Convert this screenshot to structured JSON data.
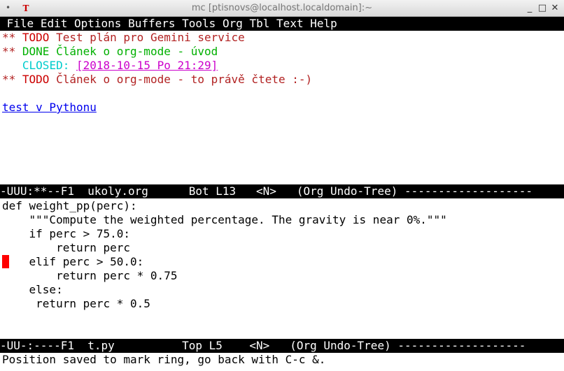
{
  "window": {
    "title": "mc [ptisnovs@localhost.localdomain]:~",
    "menu_glyph": "•",
    "app_icon": "T",
    "minimize": "_",
    "maximize": "□",
    "close": "✕"
  },
  "menubar": [
    "File",
    "Edit",
    "Options",
    "Buffers",
    "Tools",
    "Org",
    "Tbl",
    "Text",
    "Help"
  ],
  "org_buffer": {
    "lines": [
      {
        "stars": "**",
        "keyword": "TODO",
        "text": "Test plán pro Gemini service"
      },
      {
        "stars": "**",
        "keyword": "DONE",
        "text": "Článek o org-mode - úvod"
      },
      {
        "closed_label": "CLOSED:",
        "timestamp": "[2018-10-15 Po 21:29]"
      },
      {
        "stars": "**",
        "keyword": "TODO",
        "text": "Článek o org-mode - to právě čtete :-)"
      }
    ],
    "link": "test v Pythonu"
  },
  "modeline_top": "-UUU:**--F1  ukoly.org      Bot L13   <N>   (Org Undo-Tree) -------------------",
  "python_buffer": {
    "lines": [
      "def weight_pp(perc):",
      "    \"\"\"Compute the weighted percentage. The gravity is near 0%.\"\"\"",
      "    if perc > 75.0:",
      "        return perc",
      "    elif perc > 50.0:",
      "        return perc * 0.75",
      "    else:",
      "     return perc * 0.5"
    ]
  },
  "modeline_bottom": "-UU-:----F1  t.py          Top L5    <N>   (Org Undo-Tree) -------------------",
  "echo_area": "Position saved to mark ring, go back with C-c &.",
  "colors": {
    "todo": "#cc0000",
    "done": "#00b000",
    "closed": "#00cccc",
    "timestamp": "#cc00cc",
    "link": "#0000ee",
    "cursor": "#ff0000"
  }
}
